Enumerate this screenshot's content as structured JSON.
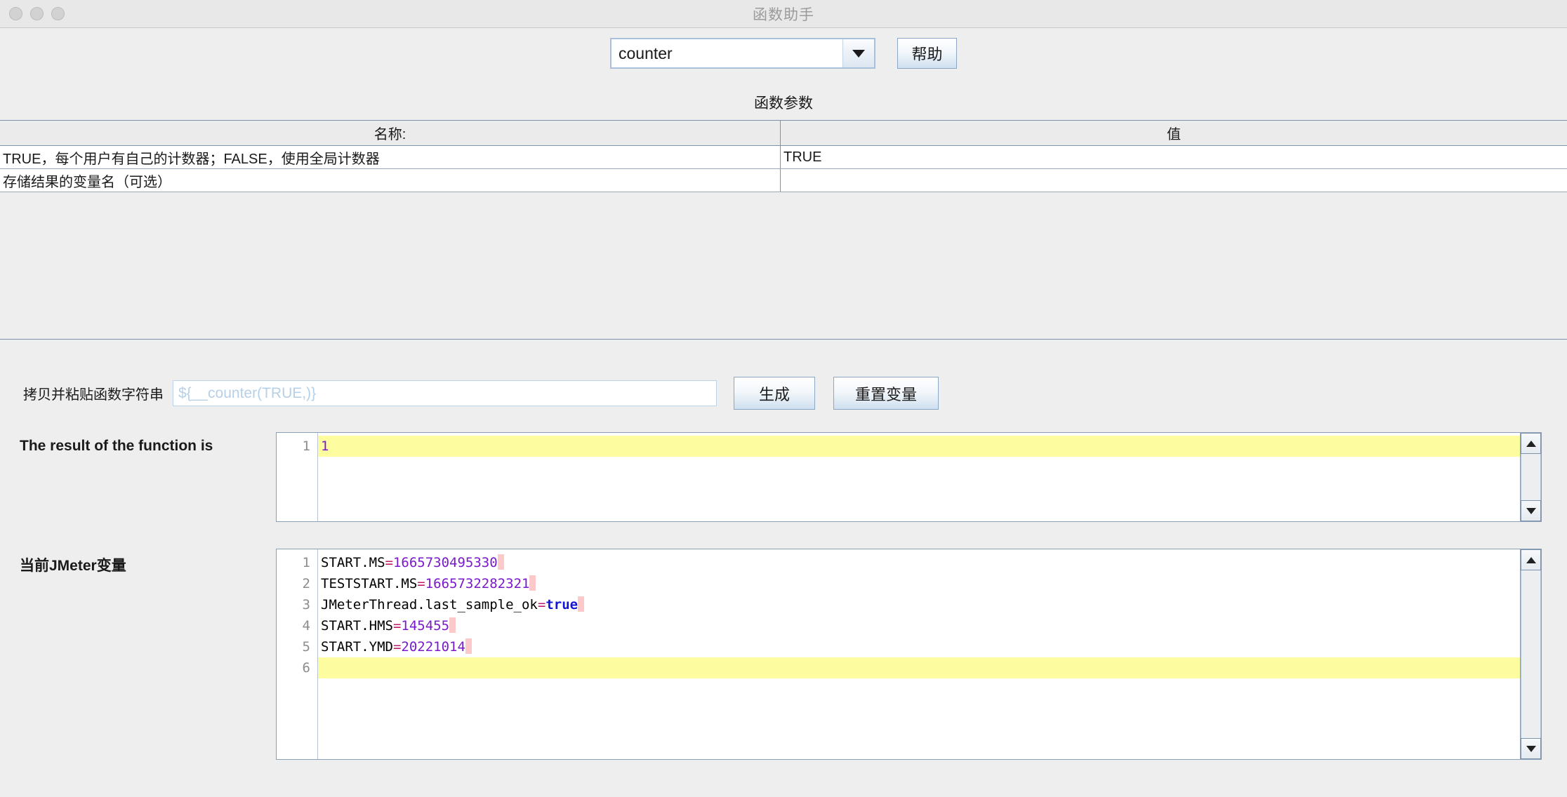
{
  "window": {
    "title": "函数助手",
    "traffic_lights": [
      "close-button",
      "minimize-button",
      "maximize-button"
    ]
  },
  "toolbar": {
    "function_select_value": "counter",
    "dropdown_icon": "chevron-down-icon",
    "help_label": "帮助"
  },
  "parameters": {
    "section_title": "函数参数",
    "columns": [
      "名称:",
      "值"
    ],
    "rows": [
      {
        "name": "TRUE，每个用户有自己的计数器；FALSE，使用全局计数器",
        "value": "TRUE"
      },
      {
        "name": "存储结果的变量名（可选）",
        "value": ""
      }
    ]
  },
  "generate": {
    "label": "拷贝并粘贴函数字符串",
    "field_value": "",
    "field_placeholder": "${__counter(TRUE,)}",
    "generate_label": "生成",
    "reset_label": "重置变量"
  },
  "result": {
    "label": "The result of the function is",
    "lines": [
      {
        "number": "1",
        "highlight": true,
        "tokens": [
          {
            "text": "1",
            "type": "num"
          }
        ]
      }
    ],
    "scroll": {
      "up_icon": "scroll-up-arrow-icon",
      "down_icon": "scroll-down-arrow-icon"
    }
  },
  "variables": {
    "label": "当前JMeter变量",
    "lines": [
      {
        "number": "1",
        "highlight": false,
        "tokens": [
          {
            "text": "START.MS",
            "type": "name"
          },
          {
            "text": "=",
            "type": "eq"
          },
          {
            "text": "1665730495330",
            "type": "val"
          },
          {
            "text": "",
            "type": "ws"
          }
        ]
      },
      {
        "number": "2",
        "highlight": false,
        "tokens": [
          {
            "text": "TESTSTART.MS",
            "type": "name"
          },
          {
            "text": "=",
            "type": "eq"
          },
          {
            "text": "1665732282321",
            "type": "val"
          },
          {
            "text": "",
            "type": "ws"
          }
        ]
      },
      {
        "number": "3",
        "highlight": false,
        "tokens": [
          {
            "text": "JMeterThread.last_sample_ok",
            "type": "name"
          },
          {
            "text": "=",
            "type": "eq"
          },
          {
            "text": "true",
            "type": "bool"
          },
          {
            "text": "",
            "type": "ws"
          }
        ]
      },
      {
        "number": "4",
        "highlight": false,
        "tokens": [
          {
            "text": "START.HMS",
            "type": "name"
          },
          {
            "text": "=",
            "type": "eq"
          },
          {
            "text": "145455",
            "type": "val"
          },
          {
            "text": "",
            "type": "ws"
          }
        ]
      },
      {
        "number": "5",
        "highlight": false,
        "tokens": [
          {
            "text": "START.YMD",
            "type": "name"
          },
          {
            "text": "=",
            "type": "eq"
          },
          {
            "text": "20221014",
            "type": "val"
          },
          {
            "text": "",
            "type": "ws"
          }
        ]
      },
      {
        "number": "6",
        "highlight": true,
        "tokens": []
      }
    ],
    "scroll": {
      "up_icon": "scroll-up-arrow-icon",
      "down_icon": "scroll-down-arrow-icon"
    }
  },
  "colors": {
    "highlight_line": "#fdfda0",
    "value_purple": "#7a19cc",
    "equals_magenta": "#c01b6a",
    "bool_blue": "#1414d6",
    "whitespace_marker": "#fbc9c9",
    "table_border": "#7d92ab",
    "button_accent": "#cfe0ef"
  }
}
